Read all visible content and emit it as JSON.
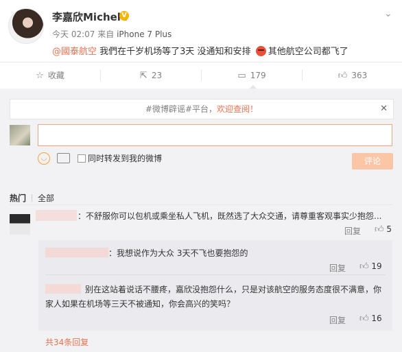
{
  "post": {
    "author": "李嘉欣Michele",
    "time": "今天 02:07",
    "source_prefix": "来自",
    "source": "iPhone 7 Plus",
    "mention": "@國泰航空",
    "text_a": "我們在千岁机场等了3天 没通知和安排",
    "text_b": "其他航空公司都飞了"
  },
  "actions": {
    "favorite": "收藏",
    "repost": "23",
    "comment": "179",
    "like": "363"
  },
  "notice": {
    "text": "#微博辟谣#平台，",
    "highlight": "欢迎查阅！"
  },
  "composer": {
    "input_value": "",
    "forward_label": "同时转发到我的微博",
    "submit_label": "评论"
  },
  "tabs": {
    "hot": "热门",
    "all": "全部"
  },
  "comments": [
    {
      "text": "：不舒服你可以包机或乘坐私人飞机，既然选了大众交通，请尊重客观事实少抱怨...",
      "reply": "回复",
      "likes": "5"
    }
  ],
  "replies": [
    {
      "text": "：我想说作为大众 3天不飞也要抱怨的",
      "reply": "回复",
      "likes": "19"
    },
    {
      "text": "别在这站着说话不腰疼，嘉欣没抱怨什么，只是对该航空的服务态度很不满意，你家人如果在机场等三天不被通知，你会高兴的笑吗？",
      "reply": "回复",
      "likes": "16"
    }
  ],
  "more_replies": "共34条回复",
  "colors": {
    "accent": "#eb7350",
    "verified": "#f7b500",
    "submit_bg": "#fcc6a6"
  },
  "icons": [
    "verified-badge-icon",
    "chevron-down-icon",
    "star-icon",
    "repost-icon",
    "comment-icon",
    "thumbs-up-icon",
    "close-icon",
    "emoji-icon",
    "image-icon",
    "angry-face-icon"
  ]
}
